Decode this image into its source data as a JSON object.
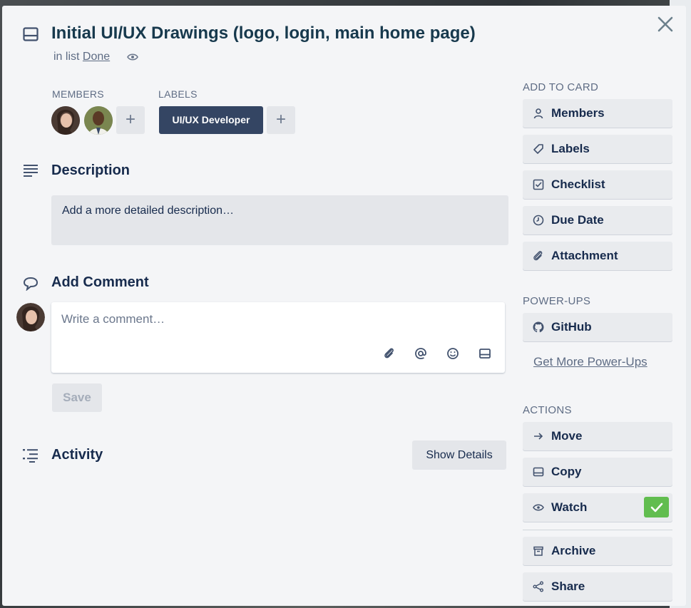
{
  "card": {
    "title": "Initial UI/UX Drawings (logo, login, main home page)",
    "in_list_prefix": "in list",
    "list_name": "Done"
  },
  "members": {
    "heading": "MEMBERS",
    "add_label": "+"
  },
  "labels": {
    "heading": "LABELS",
    "chip": "UI/UX Developer",
    "chip_color": "#344563",
    "add_label": "+"
  },
  "description": {
    "heading": "Description",
    "placeholder": "Add a more detailed description…"
  },
  "comment": {
    "heading": "Add Comment",
    "placeholder": "Write a comment…",
    "save_label": "Save"
  },
  "activity": {
    "heading": "Activity",
    "show_details": "Show Details"
  },
  "sidebar": {
    "add_to_card_heading": "ADD TO CARD",
    "add_to_card": [
      {
        "label": "Members",
        "icon": "person-icon"
      },
      {
        "label": "Labels",
        "icon": "tag-icon"
      },
      {
        "label": "Checklist",
        "icon": "checkbox-icon"
      },
      {
        "label": "Due Date",
        "icon": "clock-icon"
      },
      {
        "label": "Attachment",
        "icon": "paperclip-icon"
      }
    ],
    "powerups_heading": "POWER-UPS",
    "powerups": [
      {
        "label": "GitHub",
        "icon": "github-icon"
      }
    ],
    "get_more_powerups": "Get More Power-Ups",
    "actions_heading": "ACTIONS",
    "actions": [
      {
        "label": "Move",
        "icon": "arrow-right-icon"
      },
      {
        "label": "Copy",
        "icon": "card-icon"
      },
      {
        "label": "Watch",
        "icon": "eye-icon",
        "checked": true
      },
      {
        "label": "Archive",
        "icon": "archive-icon"
      },
      {
        "label": "Share",
        "icon": "share-icon"
      }
    ]
  },
  "colors": {
    "accent_green": "#61bd4f",
    "dialog_bg": "#f4f5f7"
  }
}
